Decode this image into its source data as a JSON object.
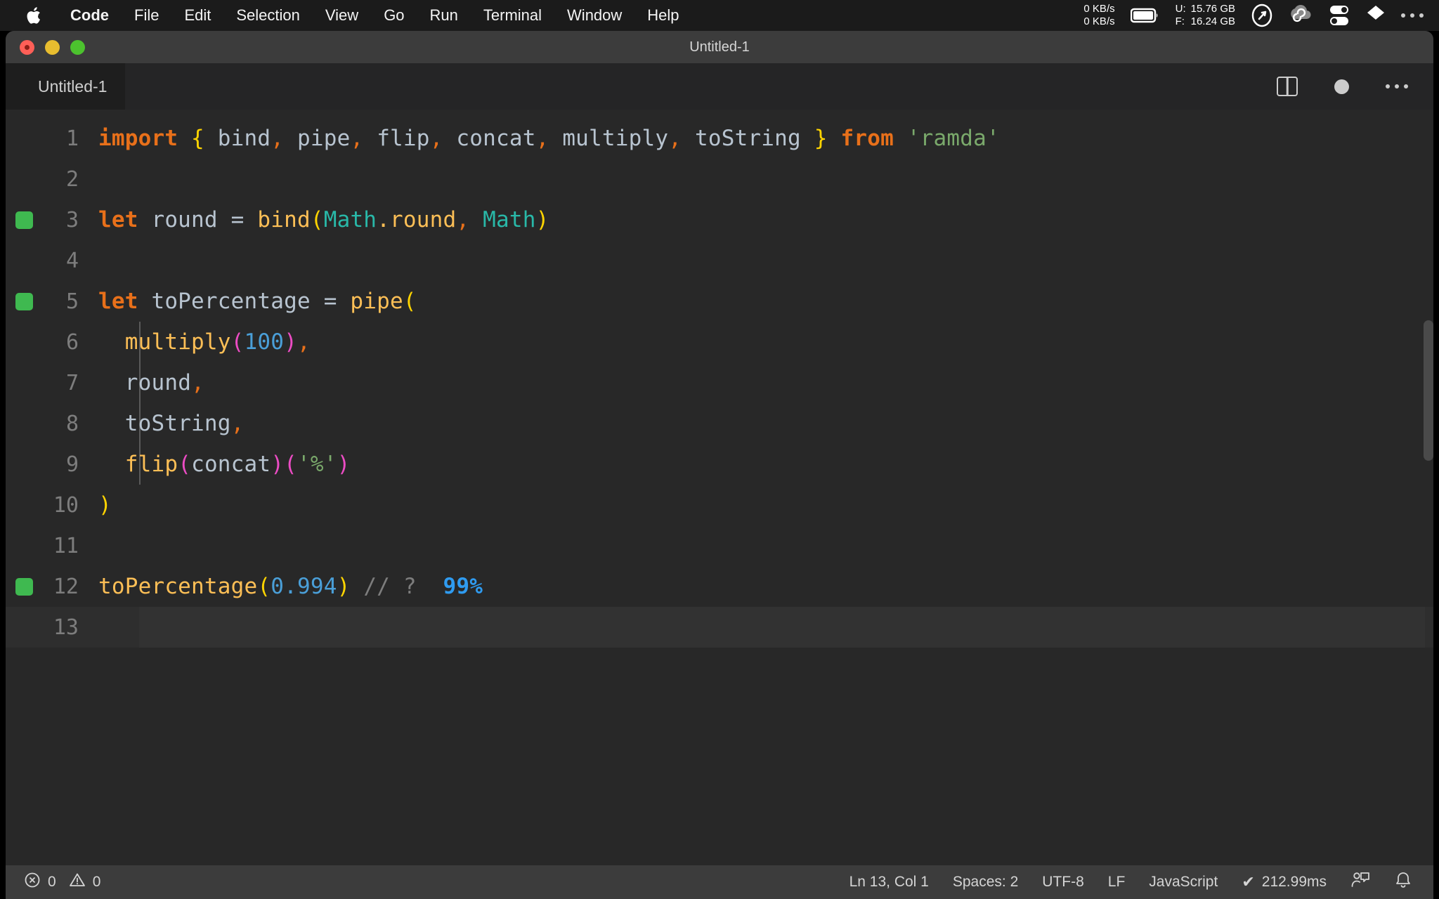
{
  "menubar": {
    "apple_icon": "apple-logo-icon",
    "items": [
      {
        "label": "Code",
        "bold": true
      },
      {
        "label": "File",
        "bold": false
      },
      {
        "label": "Edit",
        "bold": false
      },
      {
        "label": "Selection",
        "bold": false
      },
      {
        "label": "View",
        "bold": false
      },
      {
        "label": "Go",
        "bold": false
      },
      {
        "label": "Run",
        "bold": false
      },
      {
        "label": "Terminal",
        "bold": false
      },
      {
        "label": "Window",
        "bold": false
      },
      {
        "label": "Help",
        "bold": false
      }
    ],
    "network": {
      "up": "0 KB/s",
      "down": "0 KB/s"
    },
    "battery_icon": "battery-icon",
    "memory": {
      "used_key": "U:",
      "used_value": "15.76 GB",
      "free_key": "F:",
      "free_value": "16.24 GB"
    },
    "icons": [
      "speedometer-icon",
      "cloud-sync-icon",
      "toggles-icon",
      "dropbox-icon",
      "more-menu-icon"
    ]
  },
  "window": {
    "title": "Untitled-1",
    "traffic_lights": [
      "close-button",
      "minimize-button",
      "zoom-button"
    ]
  },
  "tabbar": {
    "tab_label": "Untitled-1",
    "actions": [
      "split-editor-icon",
      "unsaved-dot-icon",
      "more-actions-icon"
    ]
  },
  "editor": {
    "lines": [
      {
        "number": "1",
        "coverage": false,
        "active": false
      },
      {
        "number": "2",
        "coverage": false,
        "active": false
      },
      {
        "number": "3",
        "coverage": true,
        "active": false
      },
      {
        "number": "4",
        "coverage": false,
        "active": false
      },
      {
        "number": "5",
        "coverage": true,
        "active": false
      },
      {
        "number": "6",
        "coverage": false,
        "active": false
      },
      {
        "number": "7",
        "coverage": false,
        "active": false
      },
      {
        "number": "8",
        "coverage": false,
        "active": false
      },
      {
        "number": "9",
        "coverage": false,
        "active": false
      },
      {
        "number": "10",
        "coverage": false,
        "active": false
      },
      {
        "number": "11",
        "coverage": false,
        "active": false
      },
      {
        "number": "12",
        "coverage": true,
        "active": false
      },
      {
        "number": "13",
        "coverage": false,
        "active": true
      }
    ],
    "code": {
      "l1_import": "import",
      "l1_brace_open": " { ",
      "l1_bind": "bind",
      "l1_c1": ",",
      "l1_pipe": " pipe",
      "l1_c2": ",",
      "l1_flip": " flip",
      "l1_c3": ",",
      "l1_concat": " concat",
      "l1_c4": ",",
      "l1_multiply": " multiply",
      "l1_c5": ",",
      "l1_tostring": " toString",
      "l1_brace_close": " }",
      "l1_from": " from ",
      "l1_module": "'ramda'",
      "l3_let": "let",
      "l3_name": " round ",
      "l3_eq": "= ",
      "l3_fn": "bind",
      "l3_paren_open": "(",
      "l3_math1": "Math",
      "l3_dot_round": ".round",
      "l3_comma": ",",
      "l3_math2": " Math",
      "l3_paren_close": ")",
      "l5_let": "let",
      "l5_name": " toPercentage ",
      "l5_eq": "= ",
      "l5_fn": "pipe",
      "l5_paren": "(",
      "l6_indent": "  ",
      "l6_fn": "multiply",
      "l6_paren_open": "(",
      "l6_num": "100",
      "l6_paren_close": ")",
      "l6_comma": ",",
      "l7_indent": "  ",
      "l7_ident": "round",
      "l7_comma": ",",
      "l8_indent": "  ",
      "l8_ident": "toString",
      "l8_comma": ",",
      "l9_indent": "  ",
      "l9_fn": "flip",
      "l9_p1": "(",
      "l9_concat": "concat",
      "l9_p2": ")",
      "l9_p3": "(",
      "l9_str": "'%'",
      "l9_p4": ")",
      "l10_paren": ")",
      "l12_fn": "toPercentage",
      "l12_paren_open": "(",
      "l12_num": "0.994",
      "l12_paren_close": ")",
      "l12_comment": " // ?  ",
      "l12_result": "99%"
    }
  },
  "statusbar": {
    "error_icon": "error-circle-icon",
    "error_count": "0",
    "warning_icon": "warning-triangle-icon",
    "warning_count": "0",
    "cursor_position": "Ln 13, Col 1",
    "indentation": "Spaces: 2",
    "encoding": "UTF-8",
    "line_ending": "LF",
    "language": "JavaScript",
    "run_check": "✔",
    "run_time": "212.99ms",
    "feedback_icon": "feedback-person-icon",
    "bell_icon": "bell-icon"
  },
  "colors": {
    "keyword": "#e8701a",
    "function": "#fdbf56",
    "number": "#4a9fd8",
    "string": "#7aa96b",
    "class": "#29b8a8",
    "brace_yellow": "#ffd400",
    "paren_magenta": "#ec4cc4",
    "coverage_green": "#3fb950",
    "result_blue": "#2f9bf0",
    "editor_bg": "#282828",
    "statusbar_bg": "#3c3c3c"
  }
}
